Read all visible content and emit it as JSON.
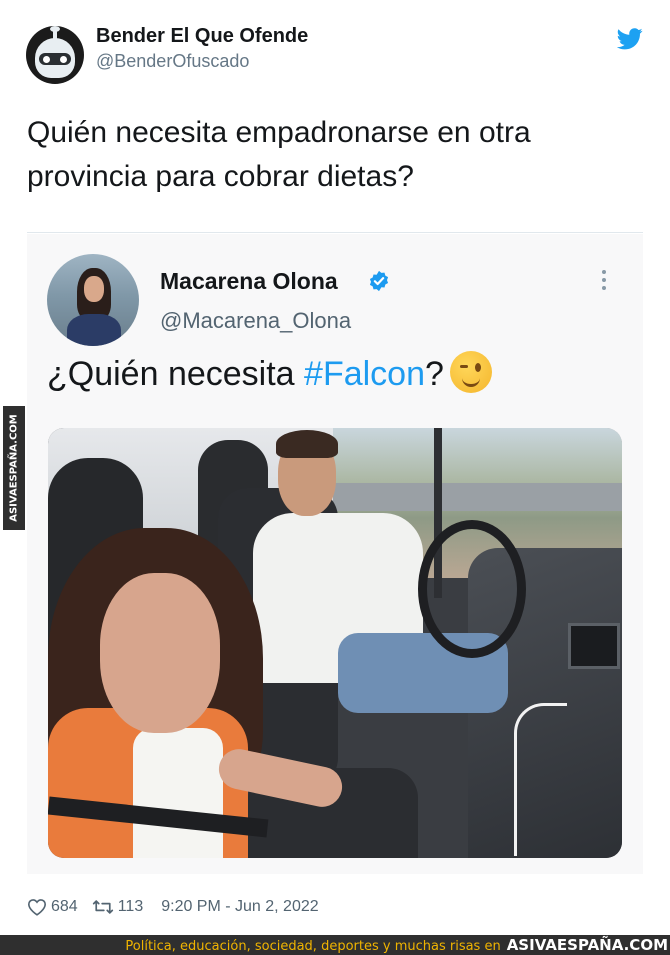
{
  "tweet": {
    "author_name": "Bender El Que Ofende",
    "author_handle": "@BenderOfuscado",
    "text": "Quién necesita empadronarse en otra provincia para cobrar dietas?",
    "avatar_icon": "bender-robot-avatar",
    "platform_icon": "twitter-bird-icon"
  },
  "quoted": {
    "author_name": "Macarena Olona",
    "author_handle": "@Macarena_Olona",
    "verified_icon": "verified-badge-icon",
    "text_before": "¿Quién necesita ",
    "hashtag": "#Falcon",
    "text_after": "?",
    "emoji": "winking-face",
    "photo": "selfie-in-van-photo"
  },
  "footer": {
    "likes": "684",
    "retweets": "113",
    "timestamp": "9:20 PM - Jun 2, 2022"
  },
  "watermark": {
    "caption": "Política, educación, sociedad, deportes y muchas risas en",
    "brand": "ASIVAESPAÑA.COM",
    "side_label": "ASIVAESPAÑA.COM"
  },
  "colors": {
    "accent": "#1d9bf0",
    "watermark_bg": "#2f2f2f",
    "watermark_text": "#f0b400"
  }
}
